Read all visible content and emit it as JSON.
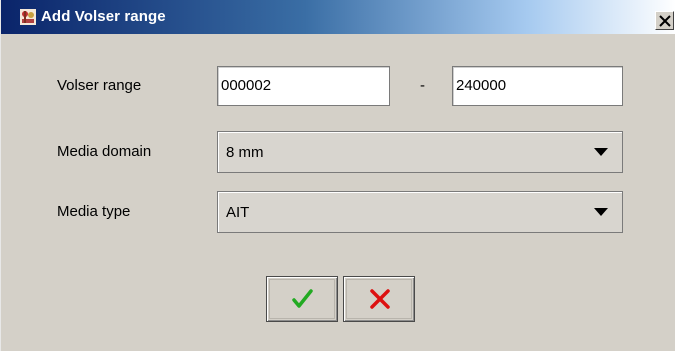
{
  "window": {
    "title": "Add Volser range",
    "title_icon": "app-icon",
    "close_icon": "close-icon"
  },
  "form": {
    "volser_range": {
      "label": "Volser range",
      "from_value": "000002",
      "separator": "-",
      "to_value": "240000"
    },
    "media_domain": {
      "label": "Media domain",
      "selected": "8 mm",
      "icon": "chevron-down-icon"
    },
    "media_type": {
      "label": "Media type",
      "selected": "AIT",
      "icon": "chevron-down-icon"
    }
  },
  "buttons": {
    "ok_icon": "checkmark-icon",
    "cancel_icon": "x-icon"
  },
  "colors": {
    "ok": "#22aa22",
    "cancel": "#dd1111",
    "titlebar": "#0a246a"
  }
}
